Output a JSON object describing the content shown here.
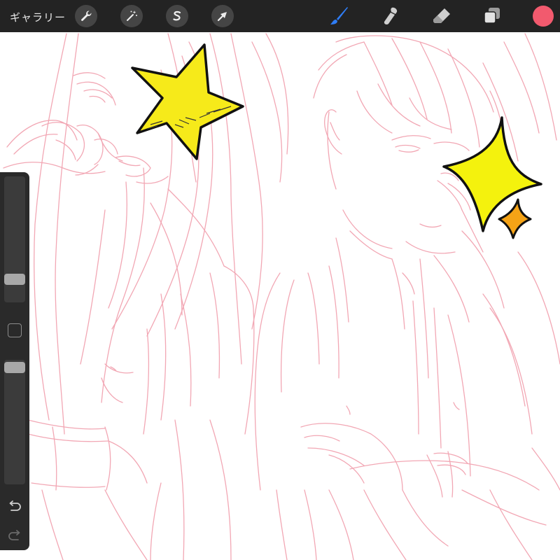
{
  "toolbar": {
    "gallery_label": "ギャラリー",
    "tools_left": [
      "wrench-icon",
      "magic-wand-icon",
      "selection-s-icon",
      "transform-arrow-icon"
    ],
    "tools_right": [
      "brush-icon",
      "smudge-icon",
      "eraser-icon",
      "layers-icon"
    ],
    "active_tool": "brush-icon",
    "active_tool_color": "#2f7df5",
    "current_color": "#f25a6e"
  },
  "sidebar": {
    "brush_size_level": 0.15,
    "opacity_level": 0.98,
    "icons": [
      "modify-square-icon",
      "undo-icon",
      "redo-icon"
    ]
  },
  "canvas": {
    "sketch_color": "#f2a7b4",
    "stickers": [
      {
        "name": "yellow-star",
        "color": "#f6ea1a"
      },
      {
        "name": "yellow-sparkle",
        "color": "#f4f20d"
      },
      {
        "name": "orange-sparkle",
        "color": "#f5a316"
      }
    ]
  }
}
